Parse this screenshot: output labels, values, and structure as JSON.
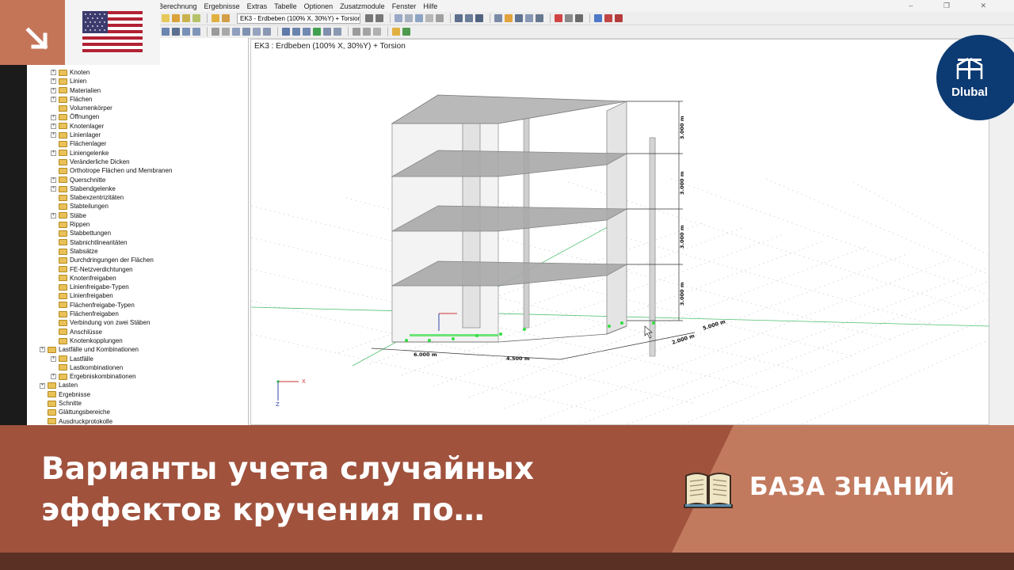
{
  "app": {
    "menu": [
      "Berechnung",
      "Ergebnisse",
      "Extras",
      "Tabelle",
      "Optionen",
      "Zusatzmodule",
      "Fenster",
      "Hilfe"
    ],
    "window_controls": "–  ❐  ✕",
    "loadcase_combo": "EK3 - Erdbeben (100% X, 30%Y) + Torsion",
    "viewport_title": "EK3 : Erdbeben (100% X, 30%Y) + Torsion"
  },
  "navigator": {
    "items": [
      {
        "label": "Knoten",
        "expandable": true
      },
      {
        "label": "Linien",
        "expandable": true
      },
      {
        "label": "Materialien",
        "expandable": true
      },
      {
        "label": "Flächen",
        "expandable": true
      },
      {
        "label": "Volumenkörper",
        "expandable": false
      },
      {
        "label": "Öffnungen",
        "expandable": true
      },
      {
        "label": "Knotenlager",
        "expandable": true
      },
      {
        "label": "Linienlager",
        "expandable": true
      },
      {
        "label": "Flächenlager",
        "expandable": false
      },
      {
        "label": "Liniengelenke",
        "expandable": true
      },
      {
        "label": "Veränderliche Dicken",
        "expandable": false
      },
      {
        "label": "Orthotrope Flächen und Membranen",
        "expandable": false
      },
      {
        "label": "Querschnitte",
        "expandable": true
      },
      {
        "label": "Stabendgelenke",
        "expandable": true
      },
      {
        "label": "Stabexzentrizitäten",
        "expandable": false
      },
      {
        "label": "Stabteilungen",
        "expandable": false
      },
      {
        "label": "Stäbe",
        "expandable": true
      },
      {
        "label": "Rippen",
        "expandable": false
      },
      {
        "label": "Stabbettungen",
        "expandable": false
      },
      {
        "label": "Stabnichtlinearitäten",
        "expandable": false
      },
      {
        "label": "Stabsätze",
        "expandable": false
      },
      {
        "label": "Durchdringungen der Flächen",
        "expandable": false
      },
      {
        "label": "FE-Netzverdichtungen",
        "expandable": false
      },
      {
        "label": "Knotenfreigaben",
        "expandable": false
      },
      {
        "label": "Linienfreigabe-Typen",
        "expandable": false
      },
      {
        "label": "Linienfreigaben",
        "expandable": false
      },
      {
        "label": "Flächenfreigabe-Typen",
        "expandable": false
      },
      {
        "label": "Flächenfreigaben",
        "expandable": false
      },
      {
        "label": "Verbindung von zwei Stäben",
        "expandable": false
      },
      {
        "label": "Anschlüsse",
        "expandable": false
      },
      {
        "label": "Knotenkopplungen",
        "expandable": false
      },
      {
        "label": "Lastfälle und Kombinationen",
        "expandable": true,
        "level": 0
      },
      {
        "label": "Lastfälle",
        "expandable": true
      },
      {
        "label": "Lastkombinationen",
        "expandable": false
      },
      {
        "label": "Ergebniskombinationen",
        "expandable": true
      },
      {
        "label": "Lasten",
        "expandable": true,
        "level": 0
      },
      {
        "label": "Ergebnisse",
        "expandable": false,
        "level": 0
      },
      {
        "label": "Schnitte",
        "expandable": false,
        "level": 0
      },
      {
        "label": "Glättungsbereiche",
        "expandable": false,
        "level": 0
      },
      {
        "label": "Ausdruckprotokolle",
        "expandable": false,
        "level": 0
      }
    ]
  },
  "model": {
    "dims_vertical": [
      "3.000 m",
      "3.000 m",
      "3.000 m",
      "3.000 m"
    ],
    "dims_x": [
      "6.000 m",
      "4.500 m"
    ],
    "dims_y": [
      "2.000 m",
      "5.000 m"
    ],
    "axis_x": "X",
    "axis_z": "Z"
  },
  "overlay": {
    "title": "Варианты учета случайных эффектов кручения по…",
    "knowledge_base": "БАЗА ЗНАНИЙ",
    "logo_text": "Dlubal",
    "colors": {
      "banner_dark": "#a0523d",
      "banner_light": "#c27a5e",
      "logo_bg": "#0c3a72",
      "support_green": "#33dd44"
    }
  }
}
